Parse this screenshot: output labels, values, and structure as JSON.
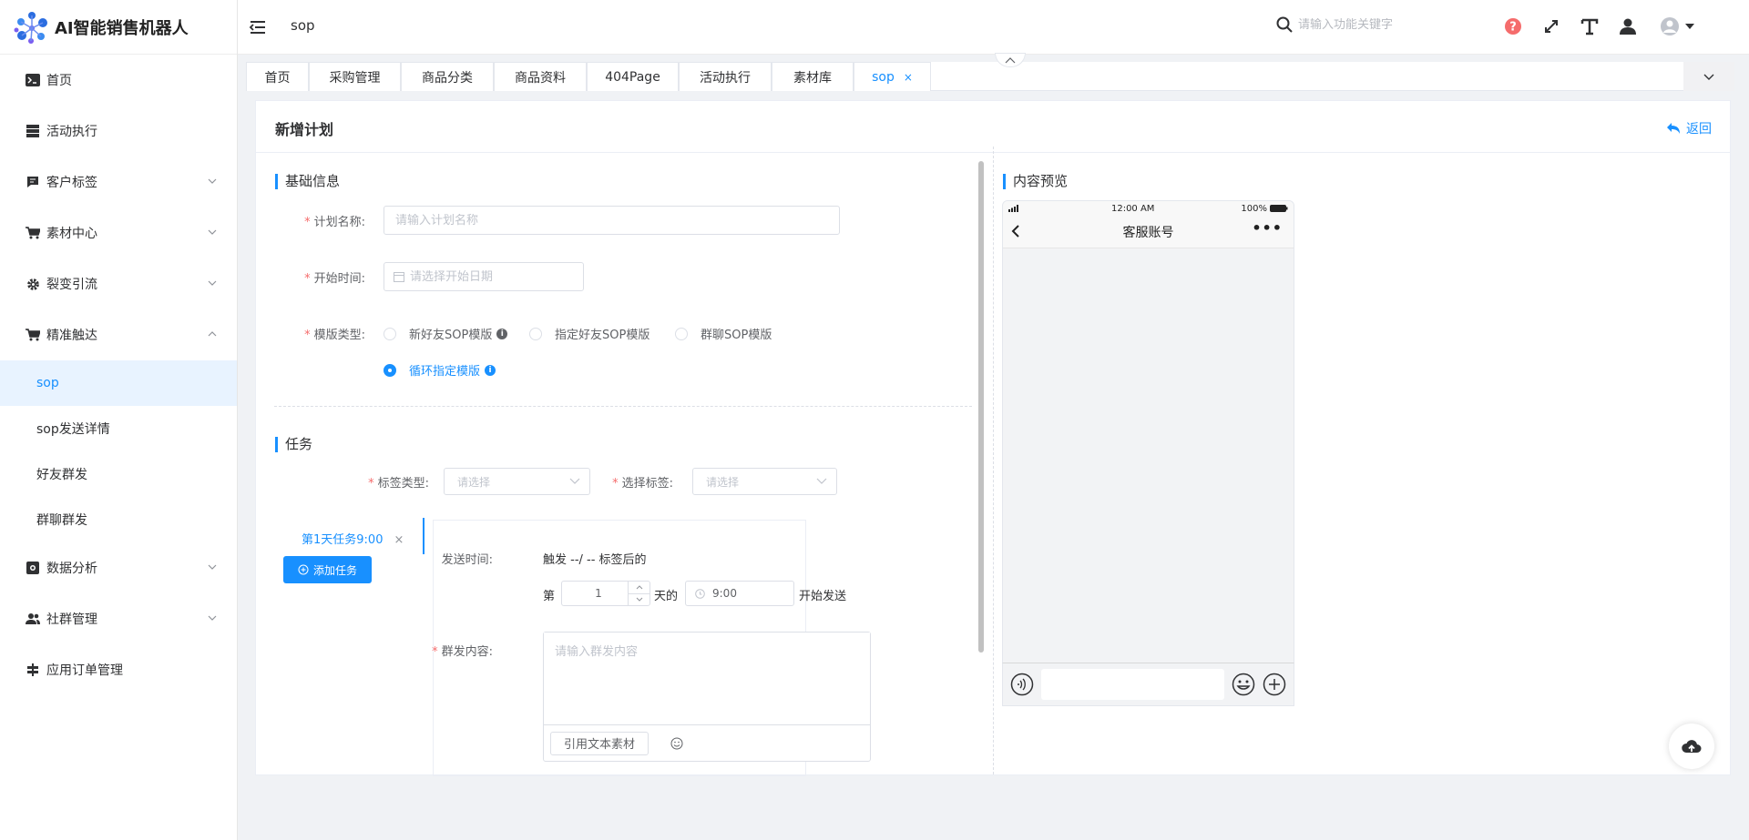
{
  "app": {
    "title": "AI智能销售机器人"
  },
  "sidebar": {
    "items": [
      {
        "label": "首页",
        "icon": "terminal-icon"
      },
      {
        "label": "活动执行",
        "icon": "server-icon"
      },
      {
        "label": "客户标签",
        "icon": "comment-icon"
      },
      {
        "label": "素材中心",
        "icon": "cart-icon"
      },
      {
        "label": "裂变引流",
        "icon": "gear-icon"
      },
      {
        "label": "精准触达",
        "icon": "cart-icon"
      },
      {
        "label": "数据分析",
        "icon": "chart-icon"
      },
      {
        "label": "社群管理",
        "icon": "users-icon"
      },
      {
        "label": "应用订单管理",
        "icon": "signpost-icon"
      }
    ],
    "subitems": [
      "sop",
      "sop发送详情",
      "好友群发",
      "群聊群发"
    ]
  },
  "header": {
    "breadcrumb": "sop",
    "search_placeholder": "请输入功能关键字"
  },
  "tabs": [
    "首页",
    "采购管理",
    "商品分类",
    "商品资料",
    "404Page",
    "活动执行",
    "素材库",
    "sop"
  ],
  "tab_close": "×",
  "panel": {
    "title": "新增计划",
    "back": "返回",
    "section_basic": "基础信息",
    "plan_name_label": "计划名称:",
    "plan_name_placeholder": "请输入计划名称",
    "start_time_label": "开始时间:",
    "start_time_placeholder": "请选择开始日期",
    "template_label": "模版类型:",
    "radios": [
      "新好友SOP模版",
      "指定好友SOP模版",
      "群聊SOP模版",
      "循环指定模版"
    ],
    "section_task": "任务",
    "tag_type_label": "标签类型:",
    "tag_select_label": "选择标签:",
    "select_placeholder": "请选择",
    "task_tab": "第1天任务9:00",
    "add_task": "添加任务",
    "send_time_label": "发送时间:",
    "trigger_text": "触发 --/ -- 标签后的",
    "day_prefix": "第",
    "day_value": "1",
    "day_suffix": "天的",
    "time_value": "9:00",
    "start_send": "开始发送",
    "content_label": "群发内容:",
    "content_placeholder": "请输入群发内容",
    "quote_button": "引用文本素材",
    "section_preview": "内容预览"
  },
  "phone": {
    "time": "12:00 AM",
    "battery": "100%",
    "title": "客服账号",
    "more": "•••"
  },
  "colors": {
    "accent": "#1890ff",
    "required": "#f56c6c",
    "badge": "#f56c6c"
  }
}
